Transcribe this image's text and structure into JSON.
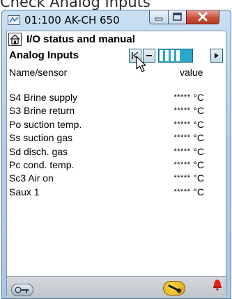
{
  "page_heading": "Check Analog Inputs",
  "window": {
    "title": "01:100 AK-CH 650",
    "controls": [
      "minimize-icon",
      "maximize-icon",
      "close-icon"
    ]
  },
  "screen": {
    "title": "I/O status and manual",
    "section": "Analog Inputs",
    "columns": {
      "name": "Name/sensor",
      "value": "value"
    }
  },
  "inputs": [
    {
      "name": "S4 Brine supply",
      "value": "*****",
      "unit": "°C"
    },
    {
      "name": "S3 Brine return",
      "value": "*****",
      "unit": "°C"
    },
    {
      "name": "Po suction temp.",
      "value": "*****",
      "unit": "°C"
    },
    {
      "name": "Ss suction gas",
      "value": "*****",
      "unit": "°C"
    },
    {
      "name": "Sd disch. gas",
      "value": "*****",
      "unit": "°C"
    },
    {
      "name": "Pc cond. temp.",
      "value": "*****",
      "unit": "°C"
    },
    {
      "name": "Sc3 Air on",
      "value": "*****",
      "unit": "°C"
    },
    {
      "name": "Saux 1",
      "value": "*****",
      "unit": "°C"
    }
  ],
  "colors": {
    "title_bar": "#b4d0ea",
    "nav_track": "#29a9c9",
    "close_button": "#c8503c",
    "alarm": "#e0201a"
  },
  "icons": {
    "home": "home-icon",
    "first_page": "first-page-icon",
    "prev_page": "prev-page-icon",
    "next_page": "next-page-icon",
    "footer_left": "keys-icon",
    "footer_mid": "service-tool-icon",
    "footer_right": "alarm-bell-icon"
  }
}
